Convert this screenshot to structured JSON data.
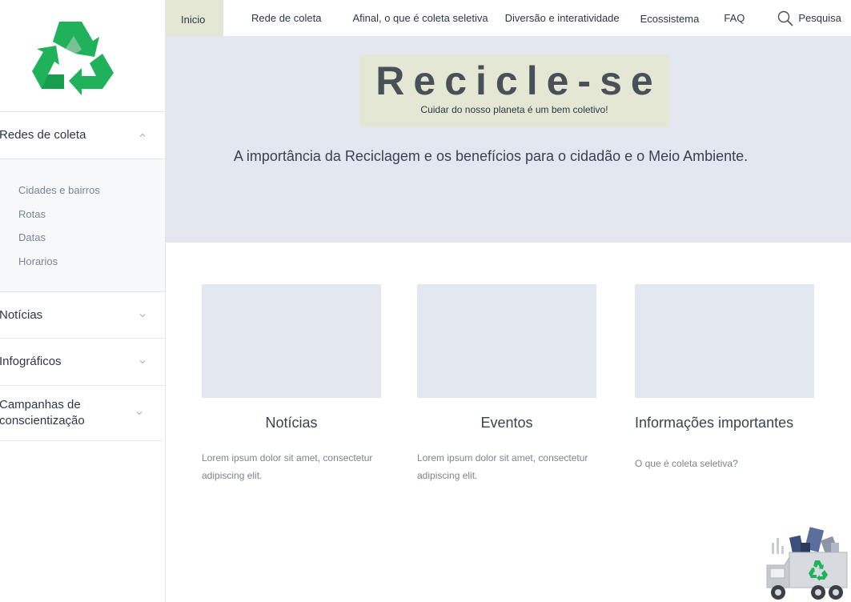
{
  "sidebar": {
    "items": [
      {
        "label": "Redes de coleta",
        "expanded": true
      },
      {
        "label": "Notícias",
        "expanded": false
      },
      {
        "label": "Infográficos",
        "expanded": false
      },
      {
        "label": "Campanhas de conscientização",
        "expanded": false
      }
    ],
    "submenu": [
      "Cidades e bairros",
      "Rotas",
      "Datas",
      "Horarios"
    ]
  },
  "nav": {
    "items": [
      "Inicio",
      "Rede de coleta",
      "Afinal, o que é coleta seletiva",
      "Diversão e interatividade",
      "Ecossistema",
      "FAQ"
    ],
    "search_label": "Pesquisa",
    "active": "Inicio"
  },
  "hero": {
    "title": "Recicle-se",
    "subtitle": "Cuidar do nosso planeta é um bem coletivo!",
    "tagline": "A importância da Reciclagem e os benefícios para o cidadão e o Meio Ambiente."
  },
  "cards": [
    {
      "title": "Notícias",
      "text": "Lorem ipsum dolor sit amet, consectetur adipiscing elit."
    },
    {
      "title": "Eventos",
      "text": "Lorem ipsum dolor sit amet, consectetur adipiscing elit."
    },
    {
      "title": "Informações importantes",
      "text": "O que é coleta seletiva?"
    }
  ],
  "colors": {
    "accent_green": "#1fb25a",
    "nav_active_bg": "#e3e7d3",
    "hero_bg": "#e3e7ef",
    "card_placeholder": "#e3e7ef"
  },
  "icons": {
    "logo": "recycle-icon",
    "search": "search-icon",
    "chevron_up": "chevron-up-icon",
    "chevron_down": "chevron-down-icon",
    "truck": "recycling-truck-icon"
  }
}
